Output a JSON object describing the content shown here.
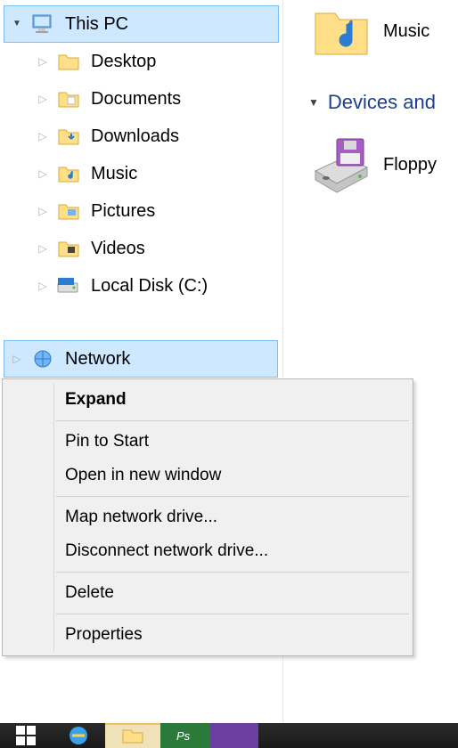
{
  "tree": {
    "root": "This PC",
    "children": [
      "Desktop",
      "Documents",
      "Downloads",
      "Music",
      "Pictures",
      "Videos",
      "Local Disk (C:)"
    ],
    "network": "Network"
  },
  "right": {
    "music": "Music",
    "section": "Devices and",
    "floppy": "Floppy"
  },
  "context_menu": {
    "expand": "Expand",
    "pin": "Pin to Start",
    "open_new": "Open in new window",
    "map": "Map network drive...",
    "disconnect": "Disconnect network drive...",
    "delete": "Delete",
    "properties": "Properties"
  }
}
